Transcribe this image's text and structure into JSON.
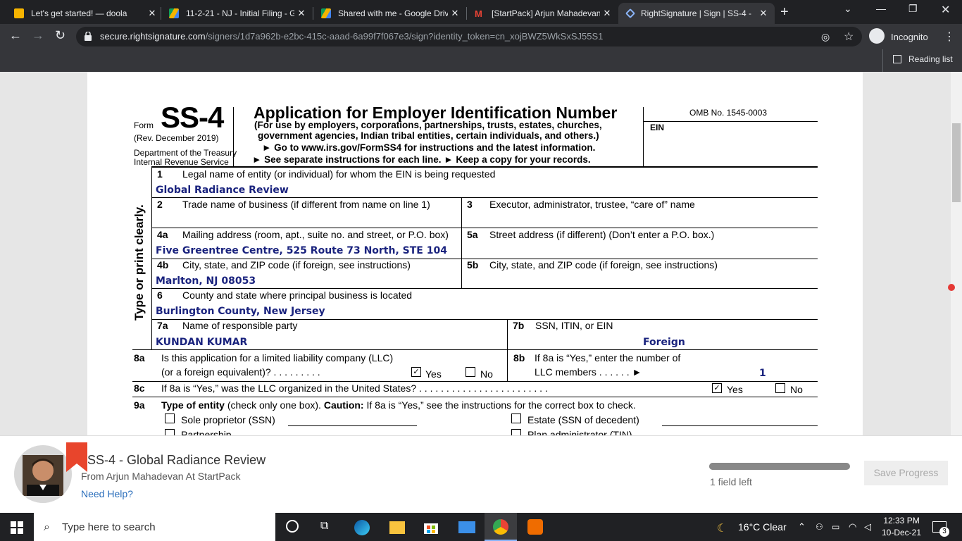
{
  "browser": {
    "tabs": [
      {
        "title": "Let's get started! — doola"
      },
      {
        "title": "11-2-21 - NJ - Initial Filing - G"
      },
      {
        "title": "Shared with me - Google Drive"
      },
      {
        "title": "[StartPack] Arjun Mahadevan"
      },
      {
        "title": "RightSignature | Sign | SS-4 -"
      }
    ],
    "url_domain": "secure.rightsignature.com",
    "url_path": "/signers/1d7a962b-e2bc-415c-aaad-6a99f7f067e3/sign?identity_token=cn_xojBWZ5WkSxSJ55S1",
    "profile_label": "Incognito",
    "reading_list": "Reading list"
  },
  "form": {
    "form_label": "Form",
    "form_number": "SS-4",
    "rev": "(Rev. December 2019)",
    "dept": "Department of the Treasury",
    "irs": "Internal Revenue Service",
    "title": "Application for Employer Identification Number",
    "subtitle1": "(For use by employers, corporations, partnerships, trusts, estates, churches,",
    "subtitle2": "government agencies, Indian tribal entities, certain individuals, and others.)",
    "goto": "► Go to www.irs.gov/FormSS4 for instructions and the latest information.",
    "separate": "► See separate instructions for each line.   ► Keep a copy for your records.",
    "omb": "OMB No. 1545-0003",
    "ein": "EIN",
    "side_label": "Type or print clearly.",
    "l1_num": "1",
    "l1_label": "Legal name of entity (or individual) for whom the EIN is being requested",
    "l1_value": "Global Radiance Review",
    "l2_num": "2",
    "l2_label": "Trade name of business (if different from name on line 1)",
    "l3_num": "3",
    "l3_label": "Executor, administrator, trustee, “care of” name",
    "l4a_num": "4a",
    "l4a_label": "Mailing address (room, apt., suite no. and street, or P.O. box)",
    "l4a_value": "Five Greentree Centre, 525 Route 73 North, STE 104",
    "l5a_num": "5a",
    "l5a_label": "Street address (if different) (Don’t enter a P.O. box.)",
    "l4b_num": "4b",
    "l4b_label": "City, state, and ZIP code (if foreign, see instructions)",
    "l4b_value": "Marlton, NJ  08053",
    "l5b_num": "5b",
    "l5b_label": "City, state, and ZIP code (if foreign, see instructions)",
    "l6_num": "6",
    "l6_label": "County and state where principal business is located",
    "l6_value": "Burlington County, New Jersey",
    "l7a_num": "7a",
    "l7a_label": "Name of responsible party",
    "l7a_value": "KUNDAN KUMAR",
    "l7b_num": "7b",
    "l7b_label": "SSN, ITIN, or EIN",
    "l7b_value": "Foreign",
    "l8a_num": "8a",
    "l8a_label1": "Is this application for a limited liability company (LLC)",
    "l8a_label2": "(or a foreign equivalent)?  .  .  .  .  .  .  .  .  .",
    "yes": "Yes",
    "no": "No",
    "l8b_num": "8b",
    "l8b_label1": "If 8a is “Yes,” enter the number of",
    "l8b_label2": "LLC members  .  .  .  .  .  .  ►",
    "l8b_value": "1",
    "l8c_num": "8c",
    "l8c_label": "If 8a is “Yes,” was the LLC organized in the United States?  .  .  .  .  .  .  .  .  .  .  .  .  .  .  .  .  .  .  .  .  .  .  .  .",
    "l9a_num": "9a",
    "l9a_label_bold": "Type of entity",
    "l9a_label": " (check only one box). ",
    "l9a_caution": "Caution:",
    "l9a_label2": " If 8a is “Yes,” see the instructions for the correct box to check.",
    "opt_sole": "Sole proprietor (SSN)",
    "opt_estate": "Estate (SSN of decedent)",
    "opt_partnership": "Partnership",
    "opt_plan": "Plan administrator (TIN)",
    "check": "✓"
  },
  "footer": {
    "doc_title": "SS-4 - Global Radiance Review",
    "from": "From Arjun Mahadevan At StartPack",
    "help": "Need Help?",
    "progress_fraction": 0.99,
    "fields_left": "1 field left",
    "save": "Save Progress"
  },
  "taskbar": {
    "search": "Type here to search",
    "weather": "16°C  Clear",
    "time": "12:33 PM",
    "date": "10-Dec-21",
    "notifications": "3"
  }
}
